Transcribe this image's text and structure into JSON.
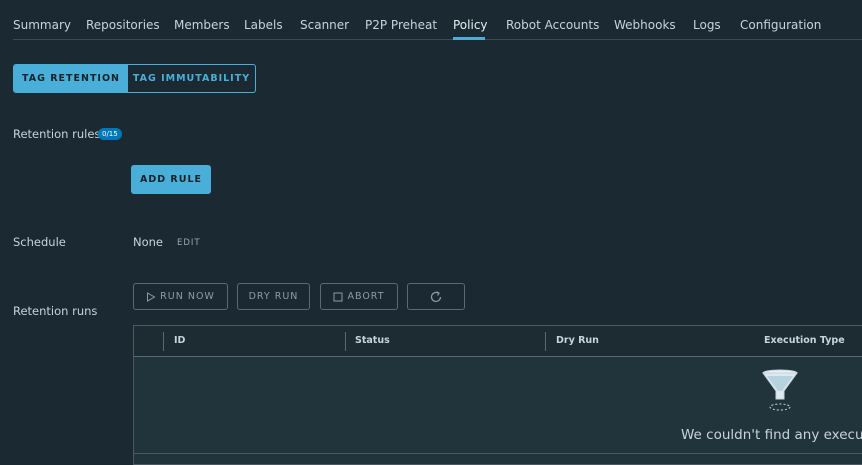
{
  "nav": {
    "tabs": [
      {
        "label": "Summary"
      },
      {
        "label": "Repositories"
      },
      {
        "label": "Members"
      },
      {
        "label": "Labels"
      },
      {
        "label": "Scanner"
      },
      {
        "label": "P2P Preheat"
      },
      {
        "label": "Policy"
      },
      {
        "label": "Robot Accounts"
      },
      {
        "label": "Webhooks"
      },
      {
        "label": "Logs"
      },
      {
        "label": "Configuration"
      }
    ],
    "active_tab": "Policy"
  },
  "policy_tabs": {
    "tag_retention": "TAG RETENTION",
    "tag_immutability": "TAG IMMUTABILITY"
  },
  "retention_rules": {
    "label": "Retention rules",
    "count_badge": "0/15",
    "add_rule_label": "ADD RULE"
  },
  "schedule": {
    "label": "Schedule",
    "value": "None",
    "edit_label": "EDIT"
  },
  "retention_runs": {
    "label": "Retention runs",
    "run_now_label": "RUN NOW",
    "dry_run_label": "DRY RUN",
    "abort_label": "ABORT",
    "refresh_icon": "refresh-icon"
  },
  "grid": {
    "columns": [
      "ID",
      "Status",
      "Dry Run",
      "Execution Type"
    ],
    "empty_icon": "funnel-icon",
    "empty_message": "We couldn't find any executions!"
  },
  "colors": {
    "background": "#1b2a32",
    "accent": "#49afd9",
    "badge": "#0079b8",
    "grid_body": "#22343b"
  }
}
